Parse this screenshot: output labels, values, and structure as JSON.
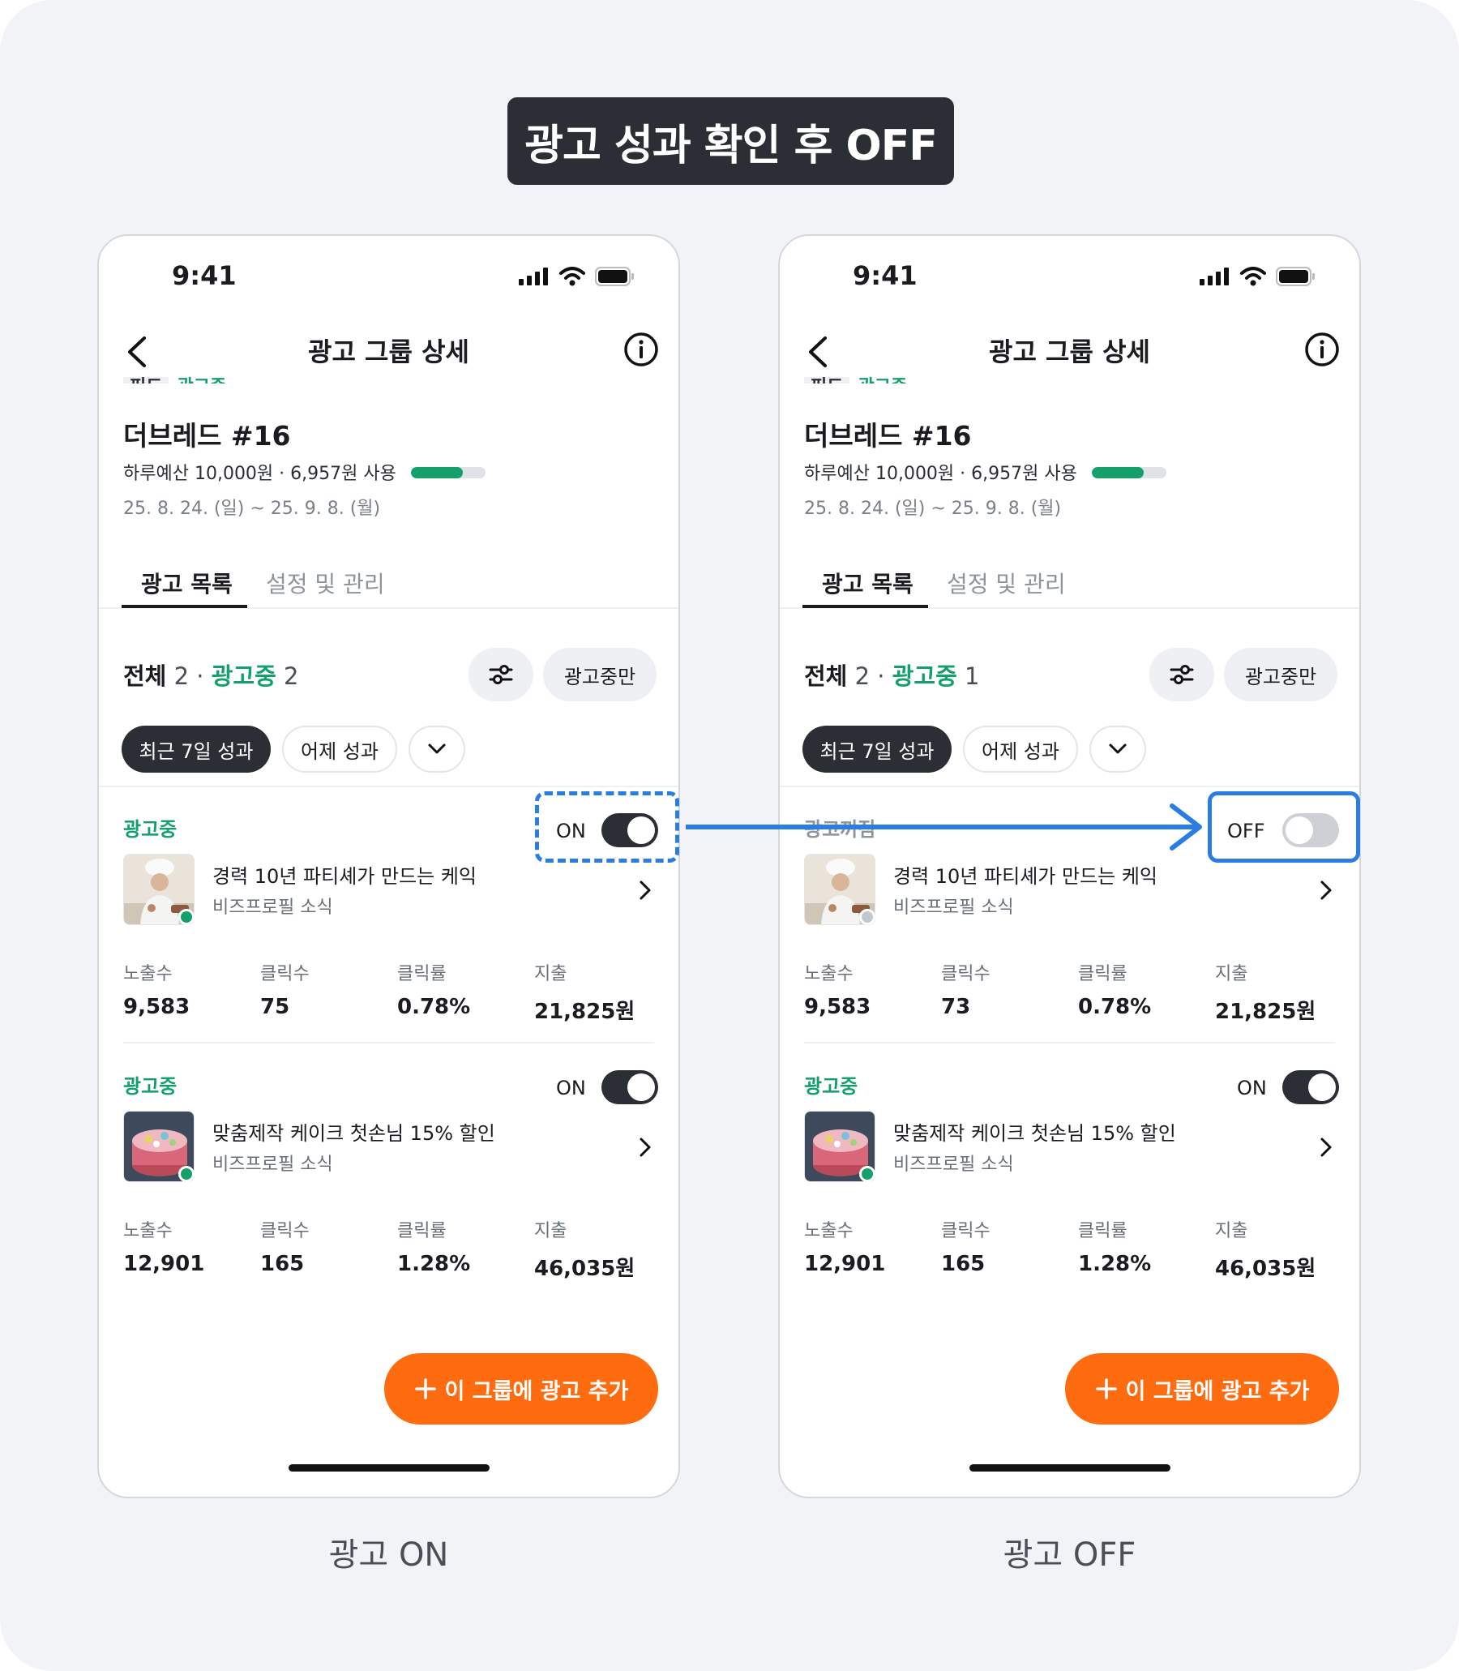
{
  "banner": "광고 성과 확인 후 OFF",
  "phones": [
    {
      "time": "9:41",
      "nav_title": "광고 그룹 상세",
      "cut_tag": "피드",
      "cut_status": "광고중",
      "campaign_title": "더브레드 #16",
      "budget_text": "하루예산 10,000원 · 6,957원 사용",
      "budget_used_fraction": 0.7,
      "dates": "25. 8. 24. (일) ~ 25. 9. 8. (월)",
      "tab_active": "광고 목록",
      "tab_inactive": "설정 및 관리",
      "summary_all_label": "전체",
      "summary_all_count": "2",
      "summary_dot": "·",
      "summary_active_label": "광고중",
      "summary_active_count": "2",
      "stop_button": "광고중만",
      "chip_recent": "최근 7일 성과",
      "chip_yesterday": "어제 성과",
      "ads": [
        {
          "status": "광고중",
          "toggle_label": "ON",
          "name": "경력 10년 파티셰가 만드는 케익",
          "sub": "비즈프로필 소식",
          "metrics": [
            {
              "label": "노출수",
              "value": "9,583"
            },
            {
              "label": "클릭수",
              "value": "75"
            },
            {
              "label": "클릭률",
              "value": "0.78%"
            },
            {
              "label": "지출",
              "value": "21,825원"
            }
          ]
        },
        {
          "status": "광고중",
          "toggle_label": "ON",
          "name": "맞춤제작 케이크 첫손님 15% 할인",
          "sub": "비즈프로필 소식",
          "metrics": [
            {
              "label": "노출수",
              "value": "12,901"
            },
            {
              "label": "클릭수",
              "value": "165"
            },
            {
              "label": "클릭률",
              "value": "1.28%"
            },
            {
              "label": "지출",
              "value": "46,035원"
            }
          ]
        }
      ],
      "fab_label": "이 그룹에 광고 추가",
      "caption": "광고 ON"
    },
    {
      "time": "9:41",
      "nav_title": "광고 그룹 상세",
      "cut_tag": "피드",
      "cut_status": "광고중",
      "campaign_title": "더브레드 #16",
      "budget_text": "하루예산 10,000원 · 6,957원 사용",
      "budget_used_fraction": 0.7,
      "dates": "25. 8. 24. (일) ~ 25. 9. 8. (월)",
      "tab_active": "광고 목록",
      "tab_inactive": "설정 및 관리",
      "summary_all_label": "전체",
      "summary_all_count": "2",
      "summary_dot": "·",
      "summary_active_label": "광고중",
      "summary_active_count": "1",
      "stop_button": "광고중만",
      "chip_recent": "최근 7일 성과",
      "chip_yesterday": "어제 성과",
      "ads": [
        {
          "status": "광고꺼짐",
          "toggle_label": "OFF",
          "name": "경력 10년 파티셰가 만드는 케익",
          "sub": "비즈프로필 소식",
          "metrics": [
            {
              "label": "노출수",
              "value": "9,583"
            },
            {
              "label": "클릭수",
              "value": "73"
            },
            {
              "label": "클릭률",
              "value": "0.78%"
            },
            {
              "label": "지출",
              "value": "21,825원"
            }
          ]
        },
        {
          "status": "광고중",
          "toggle_label": "ON",
          "name": "맞춤제작 케이크 첫손님 15% 할인",
          "sub": "비즈프로필 소식",
          "metrics": [
            {
              "label": "노출수",
              "value": "12,901"
            },
            {
              "label": "클릭수",
              "value": "165"
            },
            {
              "label": "클릭률",
              "value": "1.28%"
            },
            {
              "label": "지출",
              "value": "46,035원"
            }
          ]
        }
      ],
      "fab_label": "이 그룹에 광고 추가",
      "caption": "광고 OFF"
    }
  ],
  "colors": {
    "accent_green": "#14a06a",
    "fab_orange": "#ff6b0f",
    "highlight_blue": "#2a7de1",
    "dark": "#2b2f35"
  },
  "icons": [
    "chevron-left-icon",
    "info-icon",
    "signal-icon",
    "wifi-icon",
    "battery-icon",
    "filter-icon",
    "chevron-down-icon",
    "chevron-right-icon",
    "plus-icon",
    "arrow-right-icon"
  ]
}
